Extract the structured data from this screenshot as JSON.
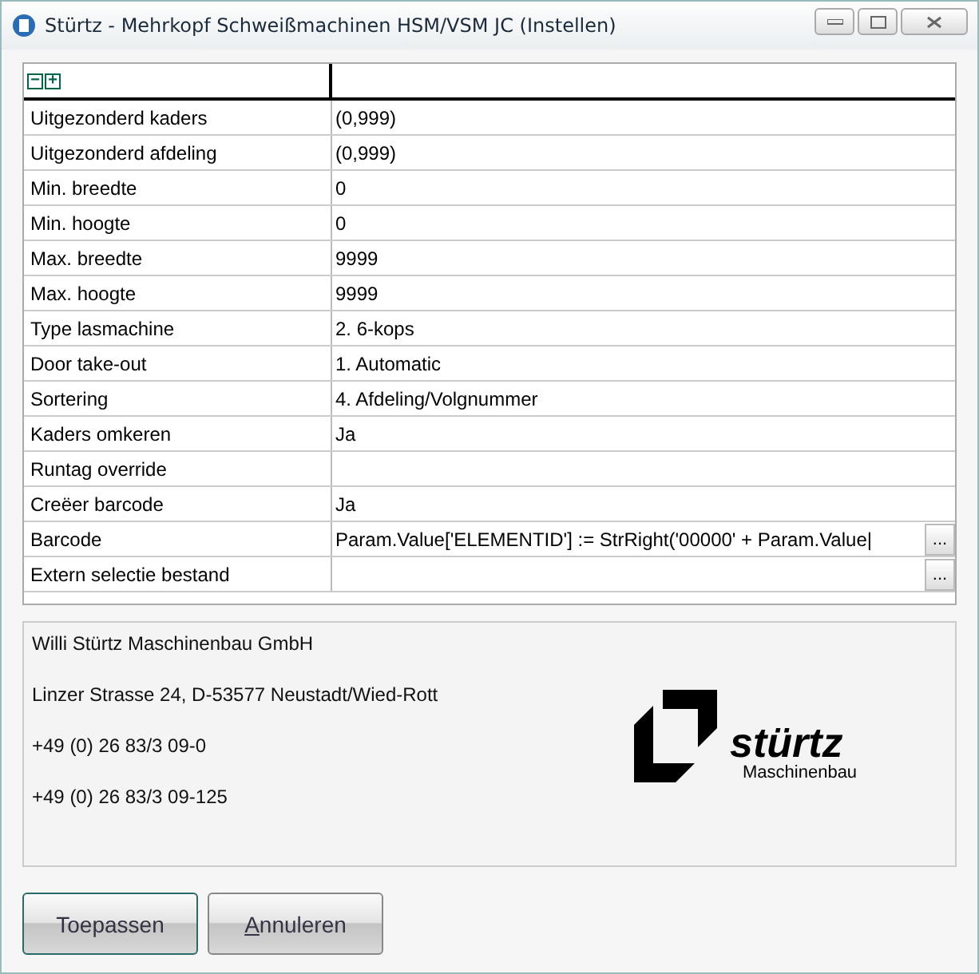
{
  "window": {
    "title": "Stürtz - Mehrkopf Schweißmachinen HSM/VSM JC (Instellen)"
  },
  "grid": {
    "toolbar": [
      "−",
      "+"
    ],
    "rows": [
      {
        "name": "Uitgezonderd kaders",
        "value": "(0,999)"
      },
      {
        "name": "Uitgezonderd afdeling",
        "value": "(0,999)"
      },
      {
        "name": "Min. breedte",
        "value": "0"
      },
      {
        "name": "Min. hoogte",
        "value": "0"
      },
      {
        "name": "Max. breedte",
        "value": "9999"
      },
      {
        "name": "Max. hoogte",
        "value": "9999"
      },
      {
        "name": "Type lasmachine",
        "value": "2. 6-kops"
      },
      {
        "name": "Door take-out",
        "value": "1. Automatic"
      },
      {
        "name": "Sortering",
        "value": "4. Afdeling/Volgnummer"
      },
      {
        "name": "Kaders omkeren",
        "value": "Ja"
      },
      {
        "name": "Runtag override",
        "value": ""
      },
      {
        "name": "Creëer barcode",
        "value": "Ja"
      },
      {
        "name": "Barcode",
        "value": "Param.Value['ELEMENTID'] := StrRight('00000' + Param.Value|",
        "button": "..."
      },
      {
        "name": "Extern selectie bestand",
        "value": "",
        "button": "..."
      }
    ]
  },
  "info": {
    "lines": [
      "Willi Stürtz Maschinenbau GmbH",
      "Linzer Strasse 24, D-53577 Neustadt/Wied-Rott",
      "+49 (0) 26 83/3 09-0",
      "+49 (0) 26 83/3 09-125"
    ],
    "logo": {
      "name": "stürtz",
      "subtitle": "Maschinenbau"
    }
  },
  "buttons": [
    {
      "label": "Toepassen",
      "default": true,
      "access_key_first": false
    },
    {
      "label": "Annuleren",
      "default": false,
      "access_key_first": true
    }
  ]
}
